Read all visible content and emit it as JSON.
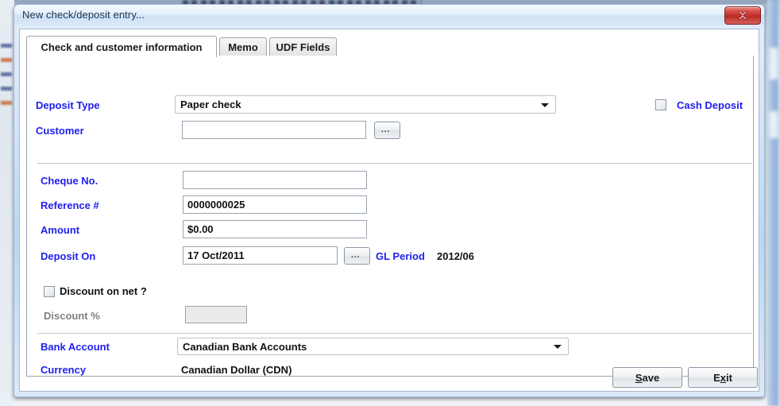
{
  "window": {
    "title": "New check/deposit entry...",
    "close_label": "x"
  },
  "tabs": [
    {
      "label": "Check and customer information",
      "active": true
    },
    {
      "label": "Memo",
      "active": false
    },
    {
      "label": "UDF Fields",
      "active": false
    }
  ],
  "form": {
    "deposit_type": {
      "label": "Deposit Type",
      "value": "Paper check"
    },
    "cash_deposit": {
      "label": "Cash Deposit",
      "checked": false
    },
    "customer": {
      "label": "Customer",
      "value": "",
      "browse_label": "..."
    },
    "cheque_no": {
      "label": "Cheque No.",
      "value": ""
    },
    "reference": {
      "label": "Reference #",
      "value": "0000000025"
    },
    "amount": {
      "label": "Amount",
      "value": "$0.00"
    },
    "deposit_on": {
      "label": "Deposit On",
      "value": "17 Oct/2011",
      "browse_label": "..."
    },
    "gl_period": {
      "label": "GL Period",
      "value": "2012/06"
    },
    "discount_on_net": {
      "label": "Discount on net ?",
      "checked": false
    },
    "discount_pct": {
      "label": "Discount %",
      "value": "",
      "disabled": true
    },
    "bank_account": {
      "label": "Bank Account",
      "value": "Canadian Bank Accounts"
    },
    "currency": {
      "label": "Currency",
      "value": "Canadian Dollar (CDN)"
    }
  },
  "buttons": {
    "save": {
      "prefix": "",
      "accel": "S",
      "suffix": "ave"
    },
    "exit": {
      "prefix": "E",
      "accel": "x",
      "suffix": "it"
    }
  },
  "colors": {
    "label_blue": "#2020f0",
    "close_red": "#bd2a24",
    "disabled_gray": "#808080"
  }
}
